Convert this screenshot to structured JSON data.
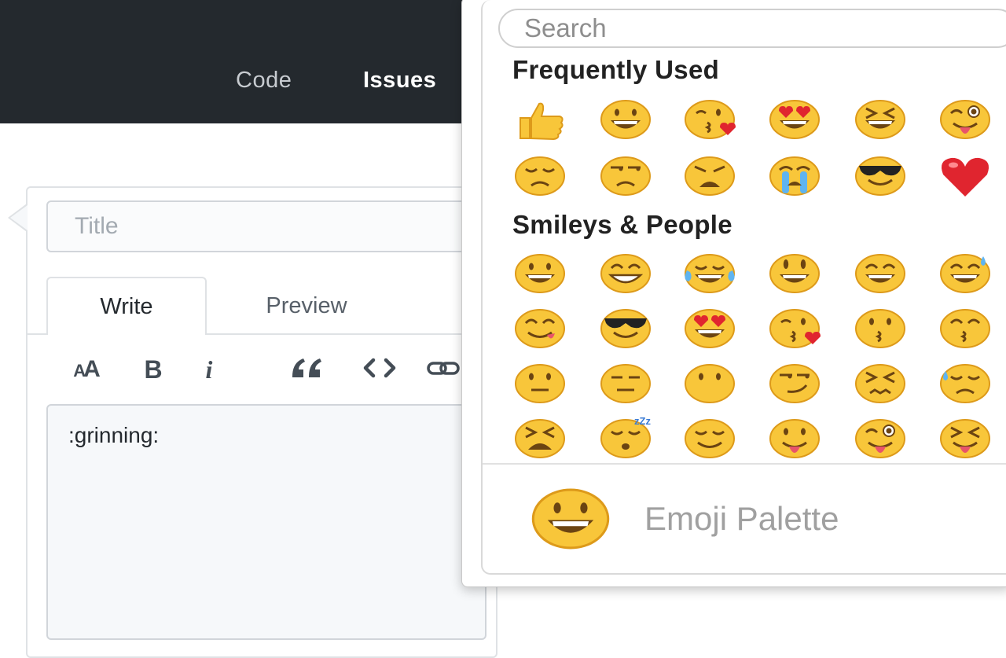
{
  "nav": {
    "items": [
      {
        "label": "Code",
        "active": false
      },
      {
        "label": "Issues",
        "active": true
      }
    ]
  },
  "issue_form": {
    "title_placeholder": "Title",
    "tabs": [
      {
        "label": "Write",
        "selected": true
      },
      {
        "label": "Preview",
        "selected": false
      }
    ],
    "toolbar": [
      {
        "name": "header",
        "label": "AA",
        "icon": "text-size-icon"
      },
      {
        "name": "bold",
        "label": "B",
        "icon": "bold-icon"
      },
      {
        "name": "italic",
        "label": "i",
        "icon": "italic-icon"
      },
      {
        "name": "quote",
        "label": "“",
        "icon": "quote-icon"
      },
      {
        "name": "code",
        "label": "<>",
        "icon": "code-icon"
      },
      {
        "name": "link",
        "icon": "link-icon"
      }
    ],
    "body_value": ":grinning:"
  },
  "emoji_picker": {
    "search_placeholder": "Search",
    "sections": [
      {
        "heading": "Frequently Used",
        "emojis": [
          "thumbsup",
          "grinning",
          "kissing-heart",
          "heart-eyes",
          "laughing",
          "stuck-out-tongue-winking-eye",
          "disappointed",
          "unamused",
          "weary",
          "sob",
          "sunglasses",
          "heart"
        ]
      },
      {
        "heading": "Smileys & People",
        "emojis": [
          "grinning",
          "grin",
          "joy",
          "smiley",
          "smile",
          "sweat-smile",
          "yum",
          "sunglasses",
          "heart-eyes",
          "kissing-heart",
          "kissing",
          "kissing-smiling-eyes",
          "neutral-face",
          "expressionless",
          "no-mouth",
          "smirk",
          "persevere",
          "disappointed-relieved",
          "tired-face",
          "sleeping",
          "relieved",
          "stuck-out-tongue",
          "stuck-out-tongue-winking-eye",
          "stuck-out-tongue-closed-eyes"
        ]
      }
    ],
    "footer": {
      "emoji": "grinning",
      "label": "Emoji Palette"
    }
  },
  "colors": {
    "nav_bg": "#24292e",
    "emoji_yellow": "#f8c63a",
    "emoji_outline": "#dd9a1a",
    "heart_red": "#e0252f"
  }
}
